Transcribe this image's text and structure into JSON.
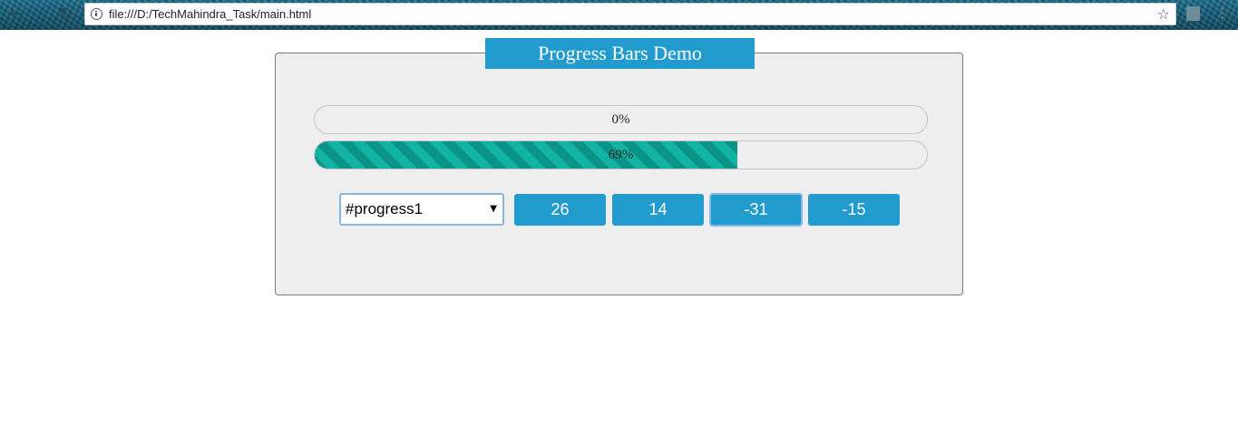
{
  "browser": {
    "url": "file:///D:/TechMahindra_Task/main.html"
  },
  "icons": {
    "back": "arrow-left-icon",
    "reload": "reload-icon",
    "info": "info-icon",
    "bookmark": "star-icon",
    "extension": "extension-icon",
    "menu": "kebab-menu-icon"
  },
  "colors": {
    "accent": "#229ccf",
    "stripe_dark": "#0a9487",
    "stripe_light": "#12b3a4",
    "panel_bg": "#eeeeee"
  },
  "demo": {
    "title": "Progress Bars Demo",
    "bars": [
      {
        "label": "0%",
        "value": 0
      },
      {
        "label": "69%",
        "value": 69
      }
    ],
    "selector": {
      "selected": "#progress1"
    },
    "buttons": [
      {
        "label": "26"
      },
      {
        "label": "14"
      },
      {
        "label": "-31"
      },
      {
        "label": "-15"
      }
    ]
  }
}
